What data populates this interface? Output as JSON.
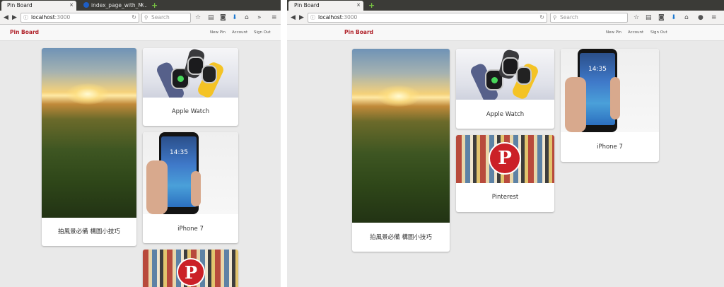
{
  "left_window": {
    "tabs": [
      {
        "label": "Pin Board",
        "close": "×"
      },
      {
        "label": "index_page_with_M…",
        "close": "×"
      }
    ],
    "newtab": "+",
    "url": {
      "host": "localhost",
      "port": ":3000"
    },
    "search_placeholder": "Search",
    "toolbar_icons": [
      "star-icon",
      "library-icon",
      "pocket-icon",
      "download-icon",
      "home-icon",
      "overflow-icon",
      "menu-icon"
    ],
    "brand": "Pin Board",
    "nav": [
      "New Pin",
      "Account",
      "Sign Out"
    ],
    "pins": [
      {
        "caption": "拍風景必備 構圖小技巧"
      },
      {
        "caption": "Apple Watch"
      },
      {
        "caption": "iPhone 7"
      },
      {
        "caption": ""
      }
    ]
  },
  "right_window": {
    "tabs": [
      {
        "label": "Pin Board",
        "close": "×"
      }
    ],
    "newtab": "+",
    "url": {
      "host": "localhost",
      "port": ":3000"
    },
    "search_placeholder": "Search",
    "toolbar_icons": [
      "star-icon",
      "library-icon",
      "pocket-icon",
      "download-icon",
      "home-icon",
      "chat-icon",
      "menu-icon"
    ],
    "brand": "Pin Board",
    "nav": [
      "New Pin",
      "Account",
      "Sign Out"
    ],
    "pins": [
      {
        "caption": "拍風景必備 構圖小技巧"
      },
      {
        "caption": "Apple Watch"
      },
      {
        "caption": "Pinterest"
      },
      {
        "caption": "iPhone 7"
      }
    ]
  },
  "glyphs": {
    "back": "◀",
    "forward": "▶",
    "info": "ⓘ",
    "reload": "↻",
    "search": "⚲",
    "star": "☆",
    "library": "▤",
    "pocket": "◙",
    "download": "⬇",
    "home": "⌂",
    "overflow": "»",
    "chat": "●",
    "menu": "≡",
    "pinterest_letter": "P",
    "phone_time": "14:35"
  },
  "colors": {
    "brand": "#b0222a",
    "tabbar": "#3b3b37",
    "page_bg": "#e9e9e9",
    "pinterest_red": "#cb2027"
  }
}
